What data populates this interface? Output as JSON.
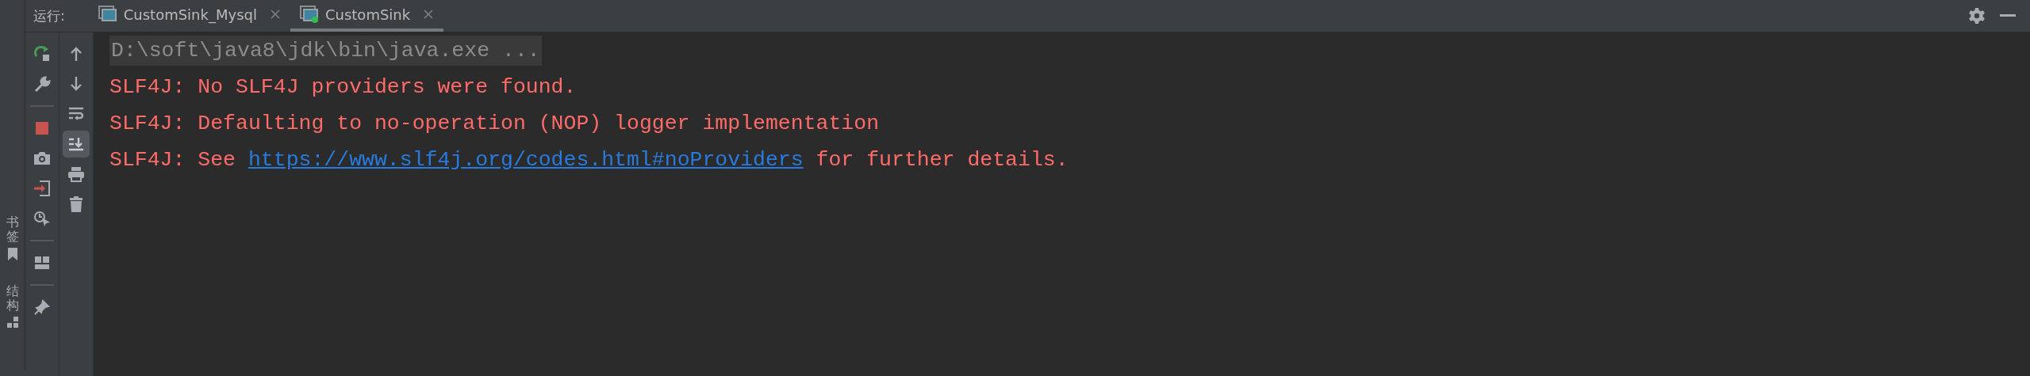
{
  "run_label": "运行:",
  "tabs": [
    {
      "label": "CustomSink_Mysql",
      "selected": false,
      "running": false
    },
    {
      "label": "CustomSink",
      "selected": true,
      "running": true
    }
  ],
  "side_labels": [
    "书签",
    "结构"
  ],
  "toolbar_left": [
    {
      "kind": "rerun"
    },
    {
      "kind": "wrench"
    },
    {
      "kind": "separator"
    },
    {
      "kind": "stop"
    },
    {
      "kind": "camera"
    },
    {
      "kind": "exit"
    },
    {
      "kind": "clock"
    },
    {
      "kind": "separator"
    },
    {
      "kind": "layout"
    },
    {
      "kind": "separator"
    },
    {
      "kind": "pin"
    }
  ],
  "toolbar_right": [
    {
      "kind": "up",
      "selected": false
    },
    {
      "kind": "down",
      "selected": false
    },
    {
      "kind": "wrap",
      "selected": false
    },
    {
      "kind": "scroll",
      "selected": true
    },
    {
      "kind": "print",
      "selected": false
    },
    {
      "kind": "trash",
      "selected": false
    }
  ],
  "console": [
    {
      "kind": "command",
      "parts": [
        {
          "kind": "text",
          "text": "D:\\soft\\java8\\jdk\\bin\\java.exe ..."
        }
      ]
    },
    {
      "kind": "error",
      "parts": [
        {
          "kind": "text",
          "text": "SLF4J: No SLF4J providers were found."
        }
      ]
    },
    {
      "kind": "error",
      "parts": [
        {
          "kind": "text",
          "text": "SLF4J: Defaulting to no-operation (NOP) logger implementation"
        }
      ]
    },
    {
      "kind": "error",
      "parts": [
        {
          "kind": "text",
          "text": "SLF4J: See "
        },
        {
          "kind": "link",
          "text": "https://www.slf4j.org/codes.html#noProviders"
        },
        {
          "kind": "text",
          "text": " for further details."
        }
      ]
    }
  ]
}
